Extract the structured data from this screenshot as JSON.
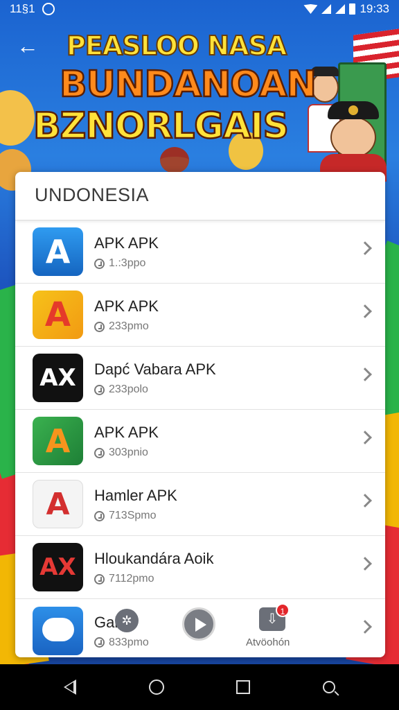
{
  "status_bar": {
    "left_text": "11§1",
    "right_text": "19:33"
  },
  "header": {
    "line1": "PEASLOO NASA",
    "line2": "BUNDANOAN",
    "line3": "BZNORLGAIS"
  },
  "card": {
    "title": "UNDONESIA",
    "items": [
      {
        "name": "APK APK",
        "meta": "1.:3ppo",
        "icon": "letter-a-blue-icon",
        "glyph": "A"
      },
      {
        "name": "APK APK",
        "meta": "233pmo",
        "icon": "letter-a-red-icon",
        "glyph": "A"
      },
      {
        "name": "Dapć Vabara APK",
        "meta": "233polo",
        "icon": "letter-ax-black-icon",
        "glyph": "AX"
      },
      {
        "name": "APK APK",
        "meta": "303pnio",
        "icon": "letter-a-green-icon",
        "glyph": "A"
      },
      {
        "name": "Hamler APK",
        "meta": "713Spmo",
        "icon": "letter-a-white-icon",
        "glyph": "A"
      },
      {
        "name": "Hloukandára Aoik",
        "meta": "7112pmo",
        "icon": "letter-ax-dark-icon",
        "glyph": "AX"
      },
      {
        "name": "Gal",
        "meta": "833pmo",
        "icon": "chat-bubble-icon",
        "glyph": ""
      }
    ]
  },
  "actions": {
    "badge_count": "1",
    "download_label": "Atvöohón"
  },
  "colors": {
    "accent_blue": "#1d63d0",
    "badge_red": "#e3262b"
  }
}
